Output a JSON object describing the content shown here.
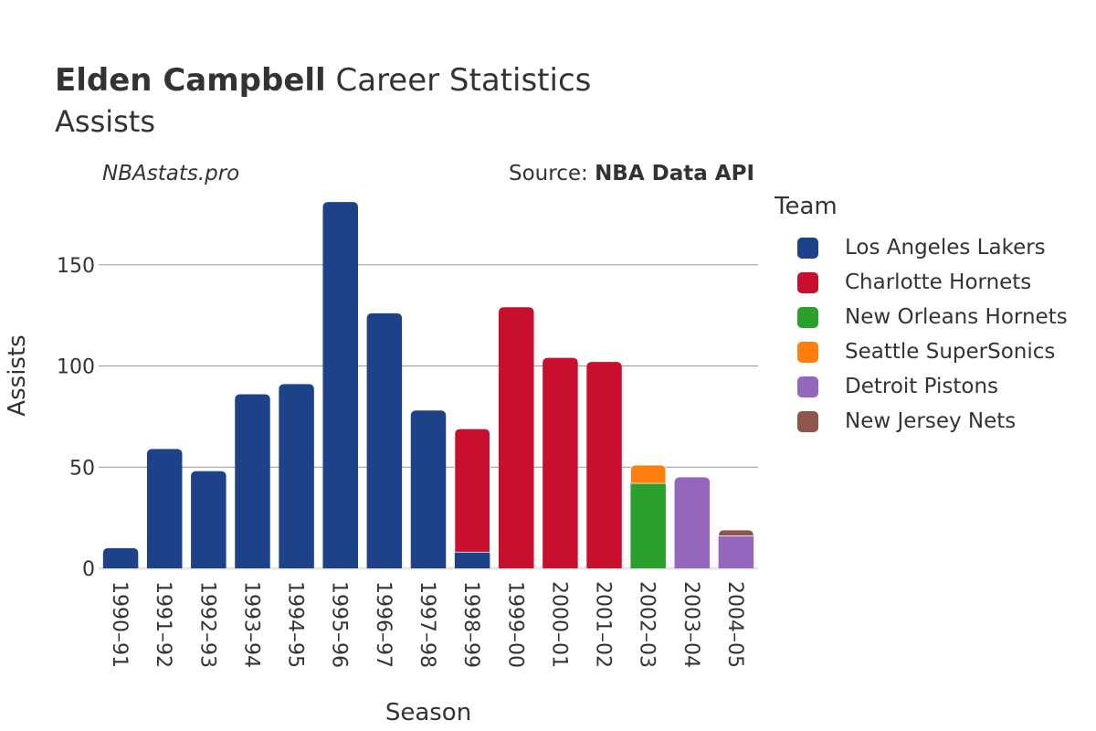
{
  "header": {
    "player_name": "Elden Campbell",
    "title_rest": "Career Statistics",
    "subtitle": "Assists",
    "site": "NBAstats.pro",
    "source_prefix": "Source: ",
    "source_name": "NBA Data API"
  },
  "legend": {
    "title": "Team",
    "items": [
      {
        "label": "Los Angeles Lakers",
        "color": "#1d428a"
      },
      {
        "label": "Charlotte Hornets",
        "color": "#c8102e"
      },
      {
        "label": "New Orleans Hornets",
        "color": "#2ca02c"
      },
      {
        "label": "Seattle SuperSonics",
        "color": "#ff7f0e"
      },
      {
        "label": "Detroit Pistons",
        "color": "#9467bd"
      },
      {
        "label": "New Jersey Nets",
        "color": "#8c564b"
      }
    ]
  },
  "chart_data": {
    "type": "bar",
    "stacked": true,
    "title": "Elden Campbell Career Statistics",
    "subtitle": "Assists",
    "xlabel": "Season",
    "ylabel": "Assists",
    "ylim": [
      0,
      190
    ],
    "yticks": [
      0,
      50,
      100,
      150
    ],
    "grid": true,
    "legend_position": "right",
    "categories": [
      "1990–91",
      "1991–92",
      "1992–93",
      "1993–94",
      "1994–95",
      "1995–96",
      "1996–97",
      "1997–98",
      "1998–99",
      "1999–00",
      "2000–01",
      "2001–02",
      "2002–03",
      "2003–04",
      "2004–05"
    ],
    "series": [
      {
        "name": "Los Angeles Lakers",
        "color": "#1d428a",
        "values": [
          10,
          59,
          48,
          86,
          91,
          181,
          126,
          78,
          8,
          0,
          0,
          0,
          0,
          0,
          0
        ]
      },
      {
        "name": "Charlotte Hornets",
        "color": "#c8102e",
        "values": [
          0,
          0,
          0,
          0,
          0,
          0,
          0,
          0,
          61,
          129,
          104,
          102,
          0,
          0,
          0
        ]
      },
      {
        "name": "New Orleans Hornets",
        "color": "#2ca02c",
        "values": [
          0,
          0,
          0,
          0,
          0,
          0,
          0,
          0,
          0,
          0,
          0,
          0,
          42,
          0,
          0
        ]
      },
      {
        "name": "Seattle SuperSonics",
        "color": "#ff7f0e",
        "values": [
          0,
          0,
          0,
          0,
          0,
          0,
          0,
          0,
          0,
          0,
          0,
          0,
          9,
          0,
          0
        ]
      },
      {
        "name": "Detroit Pistons",
        "color": "#9467bd",
        "values": [
          0,
          0,
          0,
          0,
          0,
          0,
          0,
          0,
          0,
          0,
          0,
          0,
          0,
          45,
          16
        ]
      },
      {
        "name": "New Jersey Nets",
        "color": "#8c564b",
        "values": [
          0,
          0,
          0,
          0,
          0,
          0,
          0,
          0,
          0,
          0,
          0,
          0,
          0,
          0,
          3
        ]
      }
    ]
  }
}
